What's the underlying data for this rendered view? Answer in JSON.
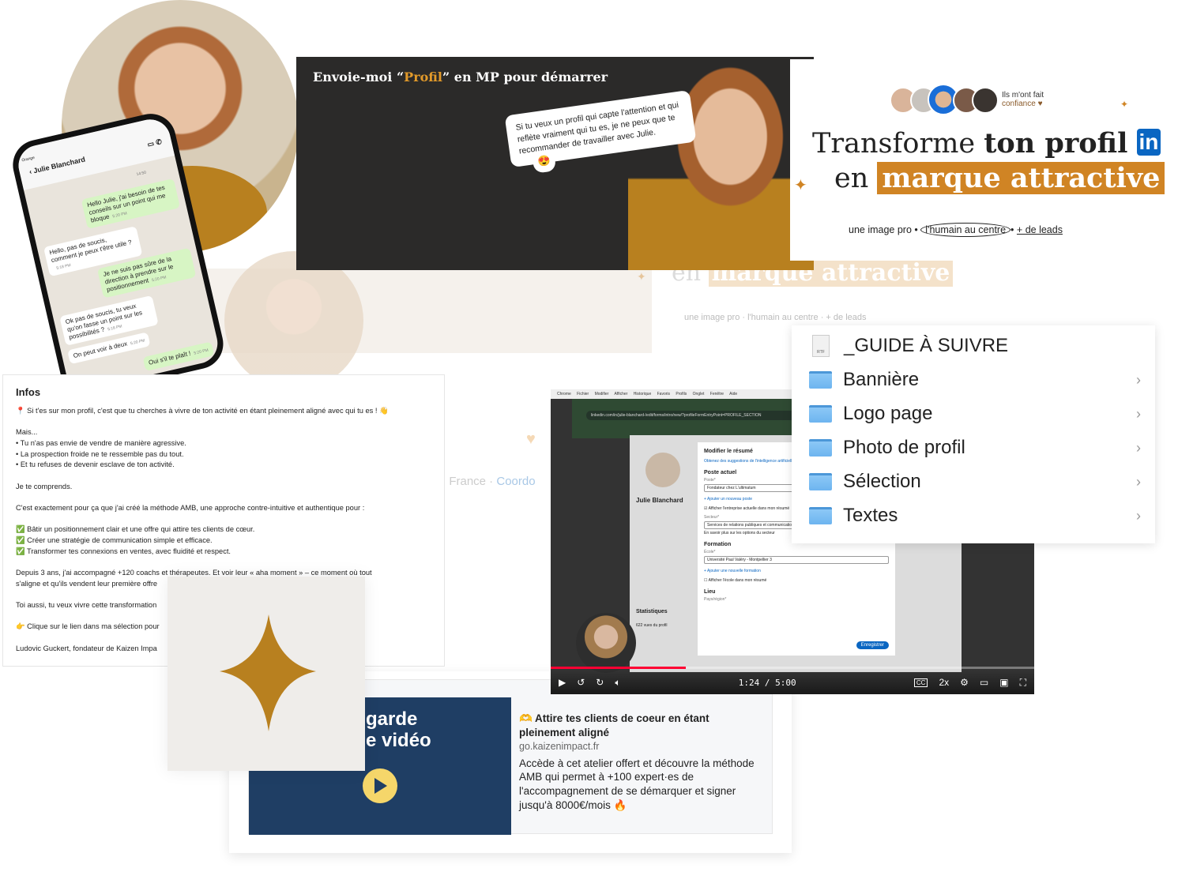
{
  "colors": {
    "accent_orange": "#d08424",
    "linkedin_blue": "#0a66c2",
    "banner_dark": "#2b2a29",
    "thumb_navy": "#1f3e64"
  },
  "banner": {
    "title_before": "Envoie-moi “",
    "title_highlight": "Profil",
    "title_after": "” en MP pour démarrer",
    "testimonial": "Si tu veux un profil qui capte l'attention et qui reflète vraiment qui tu es, je ne peux que te recommander de travailler avec Julie.",
    "emoji": "😍"
  },
  "hero": {
    "trust_line1": "Ils m'ont fait",
    "trust_line2": "confiance ♥",
    "title_regular": "Transforme ",
    "title_bold": "ton profil",
    "linkedin_badge": "in",
    "line2_prefix": "en",
    "line2_highlight": "marque attractive",
    "tag1": "une image pro",
    "tag2": "l'humain  au centre",
    "tag3": "+ de leads",
    "sep": "•"
  },
  "faded": {
    "title_prefix": "en",
    "title_highlight": "marque attractive",
    "tags": "une image pro · l'humain au centre · + de leads",
    "location": ", France · ",
    "location_link": "Coordo"
  },
  "phone": {
    "carrier": "Orange",
    "contact": "Julie Blanchard",
    "top_time": "14:50",
    "messages": [
      {
        "dir": "out",
        "text": "Hello Julie, j'ai besoin de tes conseils sur un point qui me bloque",
        "time": "5:20 PM"
      },
      {
        "dir": "in",
        "text": "Hello, pas de soucis, comment je peux t'être utile ?",
        "time": "5:18 PM"
      },
      {
        "dir": "out",
        "text": "Je ne suis pas sûre de la direction à prendre sur le positionnement",
        "time": "5:20 PM"
      },
      {
        "dir": "in",
        "text": "Ok pas de soucis, tu veux qu'on fasse un point sur les possibilités ?",
        "time": "5:18 PM"
      },
      {
        "dir": "in",
        "text": "On peut voir à deux",
        "time": "5:20 PM"
      },
      {
        "dir": "out",
        "text": "Oui s'il te plaît !",
        "time": "5:20 PM"
      }
    ]
  },
  "infos": {
    "title": "Infos",
    "paragraphs": [
      "📍 Si t'es sur mon profil, c'est que tu cherches à vivre de ton activité en étant pleinement aligné avec qui tu es ! 👋",
      "Mais...\n• Tu n'as pas envie de vendre de manière agressive.\n• La prospection froide ne te ressemble pas du tout.\n• Et tu refuses de devenir esclave de ton activité.",
      "Je te comprends.",
      "C'est exactement pour ça que j'ai créé la méthode AMB, une approche contre-intuitive et authentique pour :",
      "✅ Bâtir un positionnement clair et une offre qui attire tes clients de cœur.\n✅ Créer une stratégie de communication simple et efficace.\n✅ Transformer tes connexions en ventes, avec fluidité et respect.",
      "Depuis 3 ans, j'ai accompagné +120 coachs et thérapeutes. Et voir leur « aha moment » – ce moment où tout\ns'aligne et qu'ils vendent leur première offre",
      "Toi aussi, tu veux vivre cette transformation",
      "👉 Clique sur le lien dans ma sélection pour",
      "Ludovic Guckert, fondateur de Kaizen Impa"
    ]
  },
  "link_preview": {
    "thumb_text_1": "garde",
    "thumb_text_2": "e vidéo",
    "title": "🫶 Attire tes clients de coeur en étant pleinement aligné",
    "domain": "go.kaizenimpact.fr",
    "description": "Accède à cet atelier offert et découvre la méthode AMB qui permet à +100 expert·es de l'accompagnement de se démarquer et signer jusqu'à 8000€/mois 🔥"
  },
  "video": {
    "menu": "Chrome Fichier Modifier Afficher Historique Favoris Profils Onglet Fenêtre Aide",
    "url": "linkedin.com/in/julie-blanchard-/edit/forms/intro/new/?profileFormEntryPoint=PROFILE_SECTION",
    "profile_name": "Julie Blanchard",
    "modal_title": "Modifier le résumé",
    "ai_suggest": "Obtenez des suggestions de l'intelligence artificielle",
    "current_position": "Poste actuel",
    "position_label": "Poste*",
    "position_value": "Fondateur chez L'ultimatum",
    "add_position": "+ Ajouter un nouveau poste",
    "show_company": "Afficher l'entreprise actuelle dans mon résumé",
    "sector_label": "Secteur*",
    "sector_value": "Services de relations publiques et communication",
    "sector_help": "En savoir plus sur les options du secteur",
    "education": "Formation",
    "school_label": "École*",
    "school_value": "Université Paul Valéry - Montpellier 3",
    "add_education": "+ Ajouter une nouvelle formation",
    "show_school": "Afficher l'école dans mon résumé",
    "location": "Lieu",
    "country_label": "Pays/région*",
    "save": "Enregistrer",
    "stats": "Statistiques",
    "views": "622 vues du profil",
    "current_time": "1:24",
    "duration": "5:00",
    "speed": "2x",
    "progress_fraction": 0.28
  },
  "finder": {
    "items": [
      {
        "name": "_GUIDE À SUIVRE",
        "type": "rtf",
        "badge": "RTF"
      },
      {
        "name": "Bannière",
        "type": "folder"
      },
      {
        "name": "Logo page",
        "type": "folder"
      },
      {
        "name": "Photo de profil",
        "type": "folder"
      },
      {
        "name": "Sélection",
        "type": "folder"
      },
      {
        "name": "Textes",
        "type": "folder"
      }
    ]
  }
}
